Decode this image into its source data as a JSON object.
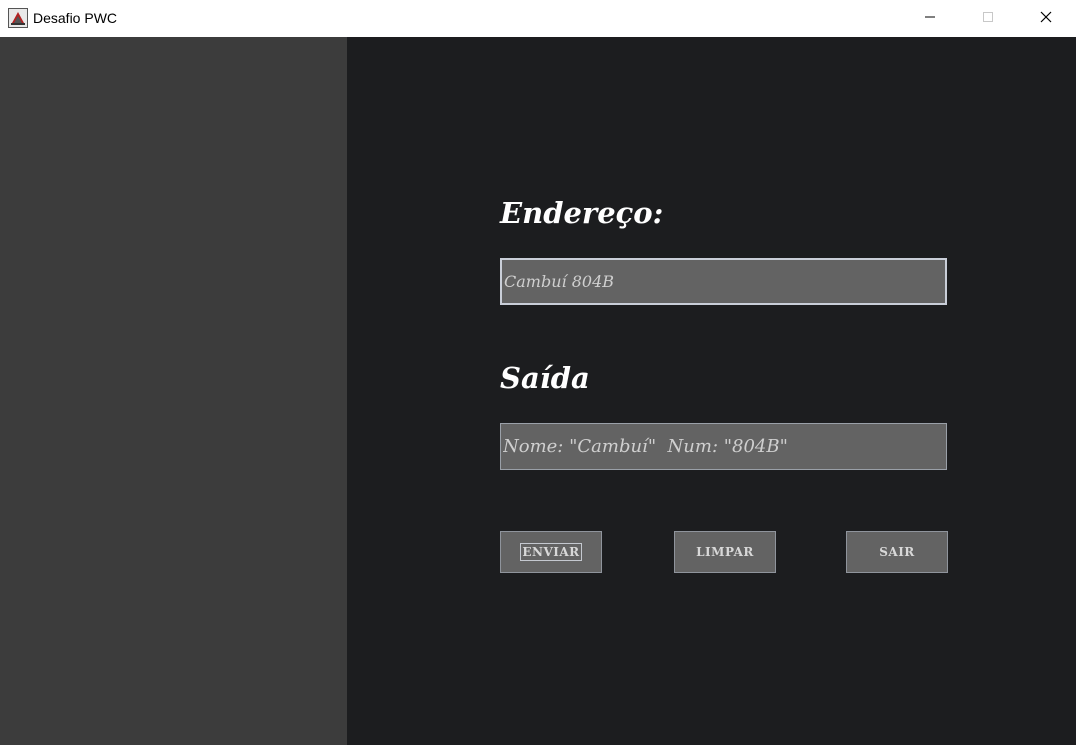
{
  "window": {
    "title": "Desafio PWC",
    "icon": "java-app-icon",
    "controls": {
      "minimize_icon": "minimize-icon",
      "maximize_icon": "maximize-icon",
      "close_icon": "close-icon"
    }
  },
  "form": {
    "address_label": "Endereço:",
    "address_value": "Cambuí 804B",
    "output_label": "Saída",
    "output_value": "Nome: \"Cambuí\"  Num: \"804B\""
  },
  "buttons": {
    "send_label": "ENVIAR",
    "clear_label": "LIMPAR",
    "exit_label": "SAIR"
  },
  "colors": {
    "left_panel": "#3c3c3c",
    "right_panel": "#1c1d1f",
    "field_bg": "#636363",
    "heading_text": "#ffffff"
  }
}
